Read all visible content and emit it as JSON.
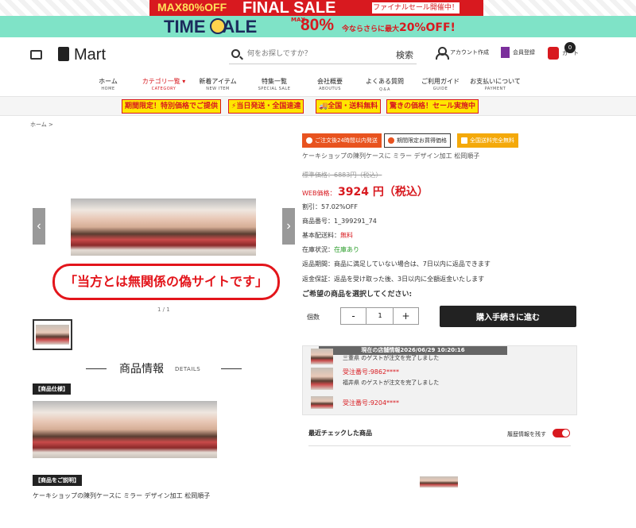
{
  "banners": {
    "final_sale": {
      "max_text": "MAX80%OFF",
      "title": "FINAL SALE",
      "notice": "ファイナルセール開催中！"
    },
    "time_sale": {
      "title": "TIME SALE",
      "max_vertical": "MAX",
      "percent": "80%",
      "more_text": "今ならさらに最大",
      "more_percent": "20%OFF!"
    }
  },
  "header": {
    "logo_text": "Mart",
    "search": {
      "placeholder": "何をお探しですか？",
      "button_label": "検索"
    },
    "account_label": "アカウント作成",
    "register_label": "会員登録",
    "cart_label": "カート",
    "cart_count": "0"
  },
  "nav": [
    {
      "jp": "ホーム",
      "en": "HOME"
    },
    {
      "jp": "カテゴリ一覧 ▾",
      "en": "CATEGORY"
    },
    {
      "jp": "新着アイテム",
      "en": "NEW ITEM"
    },
    {
      "jp": "特集一覧",
      "en": "SPECIAL SALE"
    },
    {
      "jp": "会社概要",
      "en": "ABOUTUS"
    },
    {
      "jp": "よくある質問",
      "en": "Q＆A"
    },
    {
      "jp": "ご利用ガイド",
      "en": "GUIDE"
    },
    {
      "jp": "お支払いについて",
      "en": "PAYMENT"
    }
  ],
  "promos": [
    "期間限定！特別価格でご提供",
    "⚡当日発送・全国速達",
    "🚚全国・送料無料",
    "驚きの価格！セール実施中"
  ],
  "breadcrumb": "ホーム >",
  "gallery": {
    "warning": "「当方とは無関係の偽サイトです」",
    "counter": "1 / 1",
    "prev": "‹",
    "next": "›"
  },
  "info_section": {
    "title": "商品情報",
    "title_en": "DETAILS",
    "spec_tag": "【商品仕様】",
    "desc_tag": "【商品をご説明】",
    "description": "ケーキショップの陳列ケースに ミラー デザイン加工 松岡順子"
  },
  "badges": [
    "ご注文後24時間以内発送",
    "期間限定お買得価格",
    "全国送料完全無料"
  ],
  "product": {
    "title": "ケーキショップの陳列ケースに ミラー デザイン加工 松岡順子",
    "list_price": "標準価格：6883円（税込）",
    "web_label": "WEB価格：",
    "web_price": "3924 円（税込）",
    "discount": "割引：57.02%OFF",
    "product_number": "商品番号：1_399291_74",
    "shipping_label": "基本配送料：",
    "shipping_value": "無料",
    "stock_label": "在庫状況：",
    "stock_value": "在庫あり",
    "returns": "返品期間：商品に満足していない場合は、7日以内に返品できます",
    "guarantee": "返金保証：返品を受け取った後、3日以内に全額返金いたします",
    "select_prompt": "ご希望の商品を選択してください:",
    "qty_label": "個数",
    "qty_value": "1",
    "minus": "-",
    "plus": "+",
    "buy_label": "購入手続きに進む"
  },
  "orders": {
    "header": "現在の店舗情報2026/06/29 10:20:16",
    "items": [
      {
        "num": "",
        "text": "三重県 のゲストが注文を完了しました"
      },
      {
        "num": "受注番号:9862****",
        "text": "福井県 のゲストが注文を完了しました"
      },
      {
        "num": "受注番号:9204****",
        "text": ""
      }
    ]
  },
  "recent": {
    "title": "最近チェックした商品",
    "toggle_label": "履歴情報を残す"
  },
  "colors": {
    "accent_red": "#d8191f",
    "banner_mint": "#7fe3c7",
    "promo_yellow": "#ffe600"
  }
}
